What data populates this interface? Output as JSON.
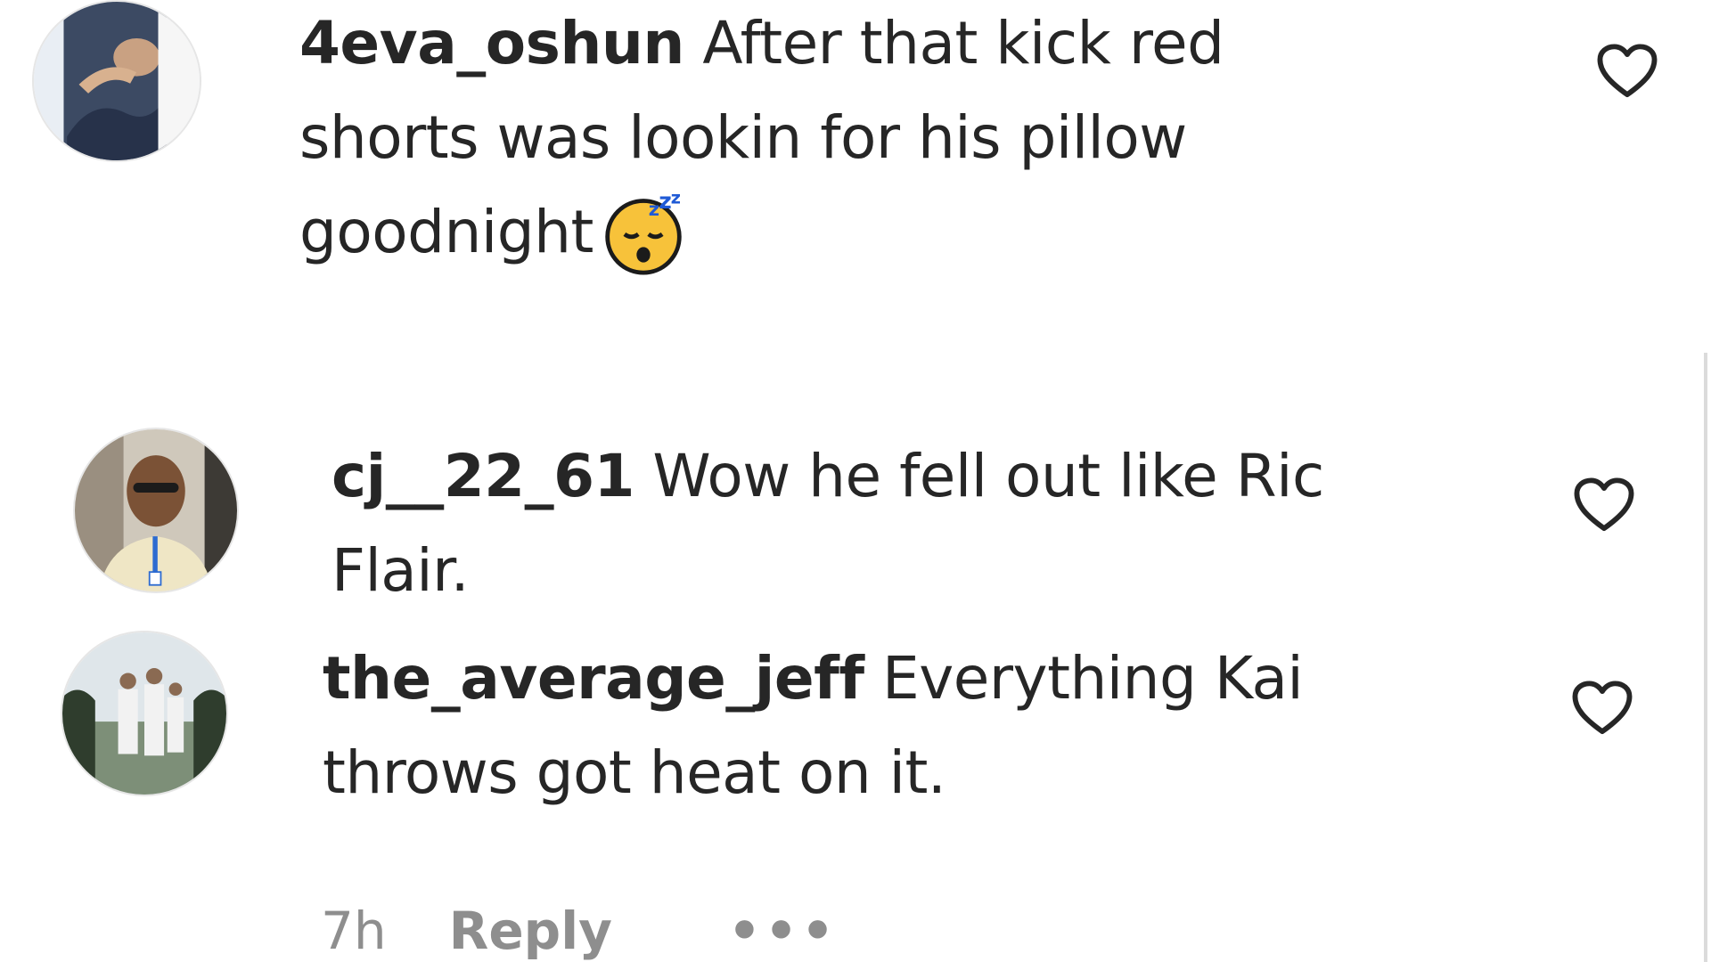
{
  "comments": [
    {
      "username": "4eva_oshun",
      "text": "After that kick red shorts was lookin for his pillow goodnight",
      "emoji": "sleeping-face-emoji",
      "avatar_icon": "user-avatar-4eva_oshun"
    },
    {
      "username": "cj__22_61",
      "text": "Wow he fell out like Ric Flair.",
      "avatar_icon": "user-avatar-cj__22_61"
    },
    {
      "username": "the_average_jeff",
      "text": "Everything Kai throws got heat on it.",
      "avatar_icon": "user-avatar-the_average_jeff"
    }
  ],
  "meta": {
    "time": "7h",
    "reply_label": "Reply",
    "more_label": "•••"
  },
  "icons": {
    "like": "heart-outline-icon",
    "more": "more-options-icon"
  },
  "colors": {
    "text": "#262626",
    "muted": "#8e8e8e",
    "background": "#ffffff",
    "divider": "#dbdbdb"
  }
}
